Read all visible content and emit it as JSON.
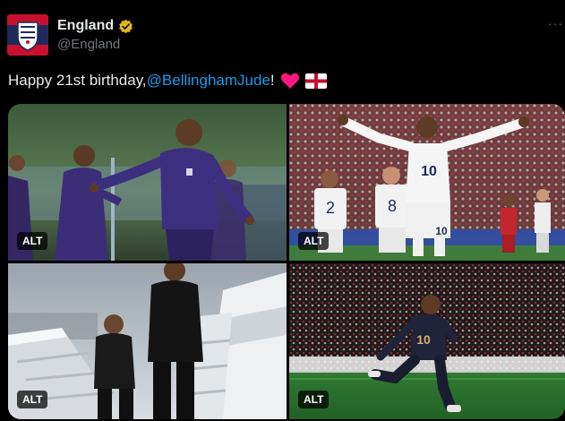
{
  "post": {
    "display_name": "England",
    "handle": "@England",
    "more_label": "···",
    "text_before": "Happy 21st birthday, ",
    "mention": "@BellinghamJude",
    "text_after": "!",
    "icons": [
      "england-crest-icon",
      "verified-badge-icon",
      "red-heart-icon",
      "england-flag-icon"
    ],
    "colors": {
      "mention": "#1d9bf0",
      "verified": "#e2b719",
      "heart": "#f91880"
    }
  },
  "media": [
    {
      "alt_label": "ALT"
    },
    {
      "alt_label": "ALT"
    },
    {
      "alt_label": "ALT"
    },
    {
      "alt_label": "ALT"
    }
  ],
  "jerseys": {
    "left_a": "2",
    "left_b": "8",
    "center": "10",
    "center_shorts": "10",
    "bottom_right": "10"
  }
}
